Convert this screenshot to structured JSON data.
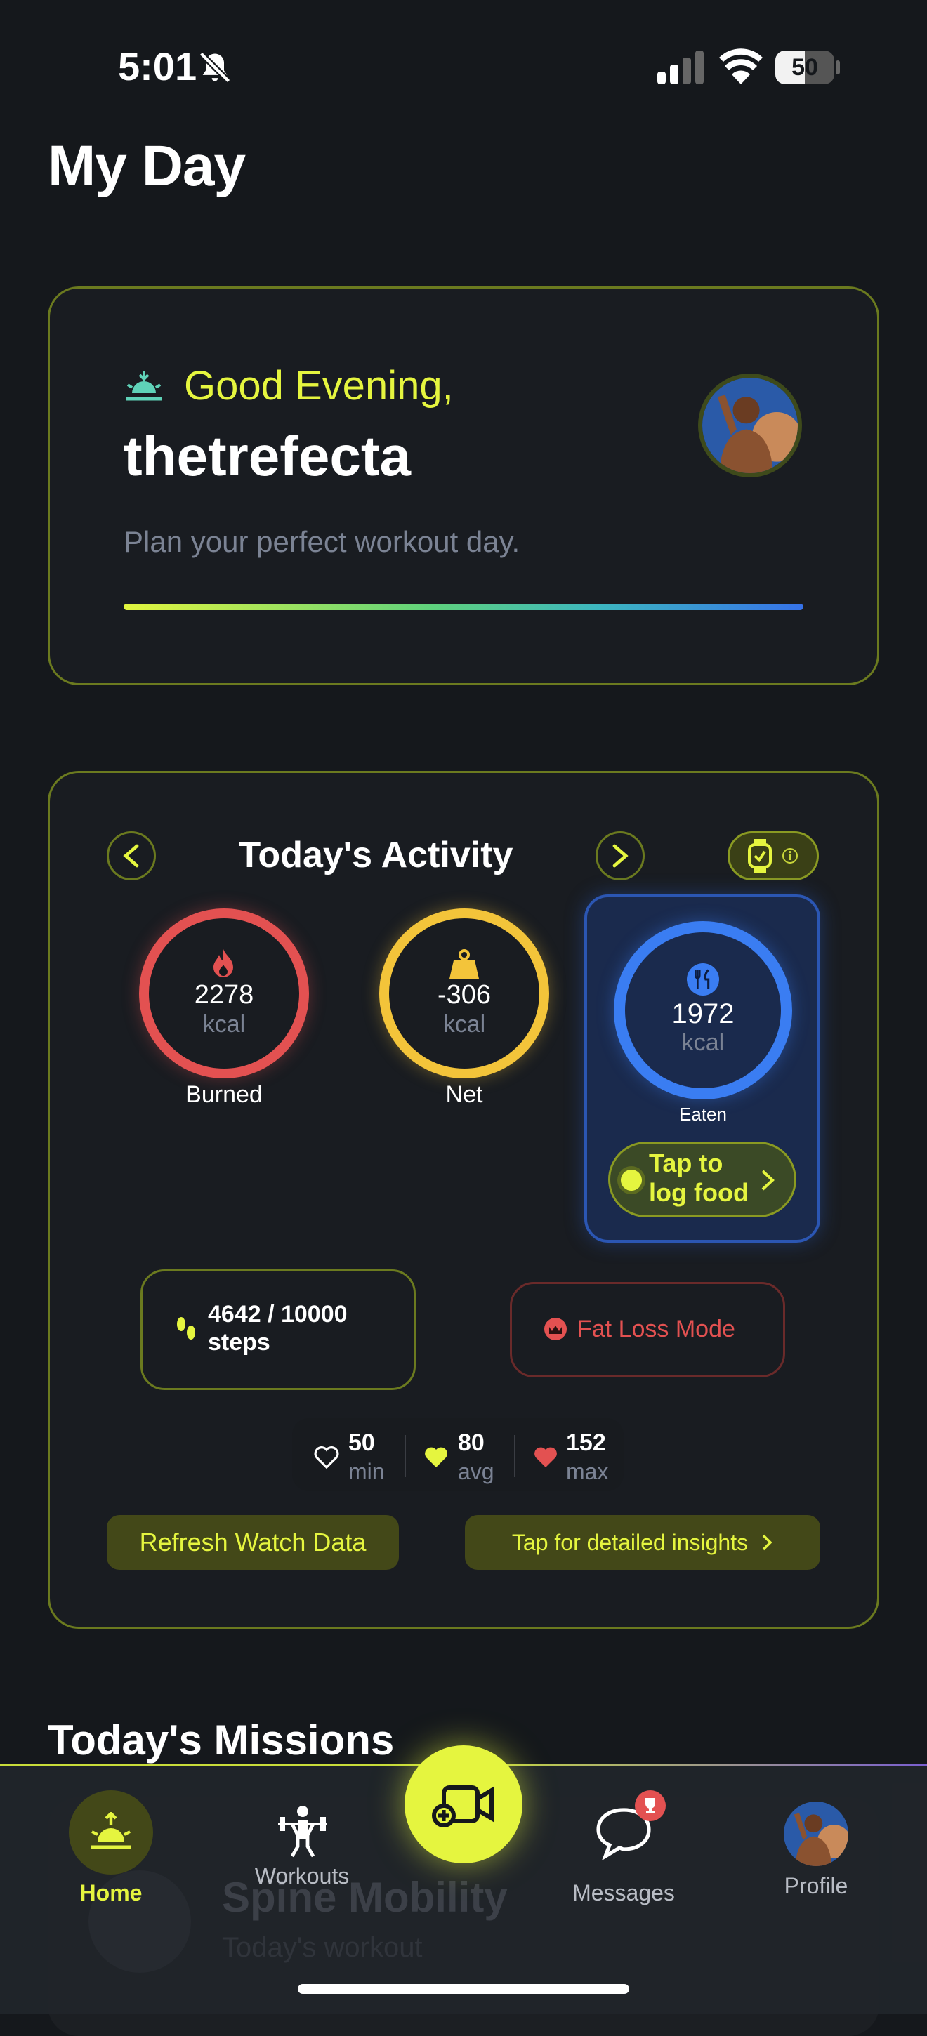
{
  "status_bar": {
    "time": "5:01",
    "battery": "50",
    "battery_level": 0.5
  },
  "page_title": "My Day",
  "greeting_card": {
    "greeting": "Good Evening,",
    "username": "thetrefecta",
    "subtitle": "Plan your perfect workout day."
  },
  "activity": {
    "title": "Today's Activity",
    "burned": {
      "value": "2278",
      "unit": "kcal",
      "label": "Burned",
      "color": "#e35151"
    },
    "net": {
      "value": "-306",
      "unit": "kcal",
      "label": "Net",
      "color": "#f3c43a"
    },
    "eaten": {
      "value": "1972",
      "unit": "kcal",
      "label": "Eaten",
      "color": "#3a7df2"
    },
    "log_food_label": "Tap to log food",
    "steps_label": "4642 / 10000 steps",
    "fat_loss_label": "Fat Loss Mode",
    "heart_rate": {
      "min_value": "50",
      "min_unit": "min",
      "avg_value": "80",
      "avg_unit": "avg",
      "max_value": "152",
      "max_unit": "max"
    },
    "refresh_label": "Refresh Watch Data",
    "insights_label": "Tap for detailed insights"
  },
  "missions": {
    "title": "Today's Missions",
    "card_title": "Spine Mobility",
    "card_subtitle": "Today's workout"
  },
  "nav": {
    "home": "Home",
    "workouts": "Workouts",
    "messages": "Messages",
    "profile": "Profile"
  },
  "colors": {
    "accent": "#e5f53f",
    "background": "#15181c",
    "card_border": "#6b7a1f",
    "danger": "#e35151",
    "eaten_blue": "#3a7df2"
  }
}
